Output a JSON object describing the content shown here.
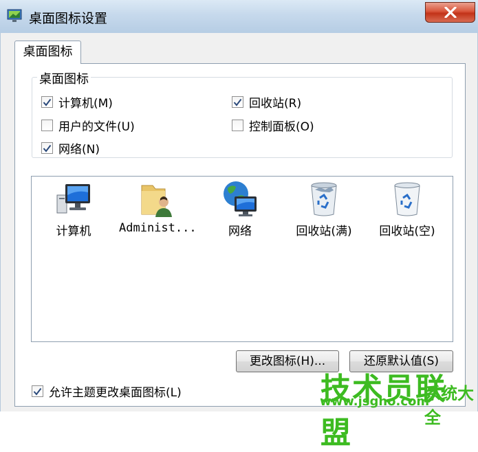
{
  "window": {
    "title": "桌面图标设置"
  },
  "tabs": [
    {
      "label": "桌面图标"
    }
  ],
  "group": {
    "legend": "桌面图标",
    "checkboxes": [
      {
        "label": "计算机(M)",
        "checked": true
      },
      {
        "label": "回收站(R)",
        "checked": true
      },
      {
        "label": "用户的文件(U)",
        "checked": false
      },
      {
        "label": "控制面板(O)",
        "checked": false
      },
      {
        "label": "网络(N)",
        "checked": true
      }
    ]
  },
  "icons": [
    {
      "label": "计算机",
      "icon": "computer-icon"
    },
    {
      "label": "Administ...",
      "icon": "user-folder-icon"
    },
    {
      "label": "网络",
      "icon": "network-icon"
    },
    {
      "label": "回收站(满)",
      "icon": "recycle-bin-full-icon"
    },
    {
      "label": "回收站(空)",
      "icon": "recycle-bin-empty-icon"
    }
  ],
  "buttons": {
    "change_icon": "更改图标(H)...",
    "restore_default": "还原默认值(S)"
  },
  "allow_theme": {
    "label": "允许主题更改桌面图标(L)",
    "checked": true
  },
  "watermark": {
    "brand": "技术员联盟",
    "url": "www.jsgho.com",
    "side": "系统大全"
  },
  "colors": {
    "accent_green": "#3dbb21",
    "close_red": "#c23318"
  }
}
